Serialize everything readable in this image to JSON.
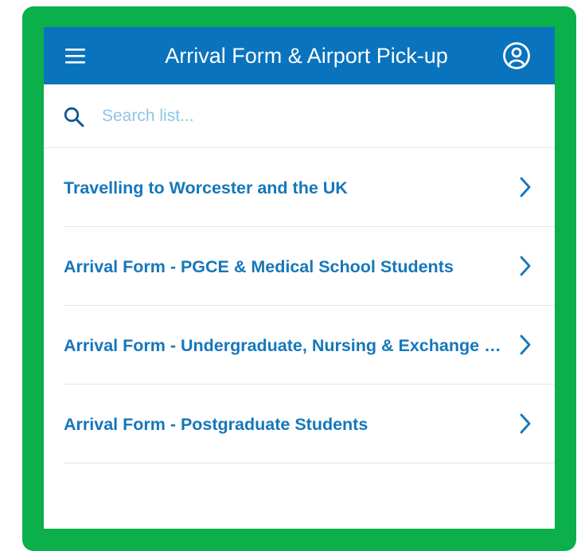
{
  "header": {
    "title": "Arrival Form & Airport Pick-up",
    "menu_icon": "hamburger-menu-icon",
    "account_icon": "user-account-icon"
  },
  "search": {
    "placeholder": "Search list...",
    "value": "",
    "icon": "search-icon"
  },
  "list": {
    "items": [
      {
        "label": "Travelling to Worcester and the UK"
      },
      {
        "label": "Arrival Form - PGCE & Medical School Students"
      },
      {
        "label": "Arrival Form - Undergraduate, Nursing & Exchange Students"
      },
      {
        "label": "Arrival Form - Postgraduate Students"
      }
    ]
  },
  "colors": {
    "frame": "#0bb04b",
    "header": "#0a73be",
    "link": "#1577bb",
    "placeholder": "#8fc4e6",
    "divider": "#e6e6e6"
  }
}
